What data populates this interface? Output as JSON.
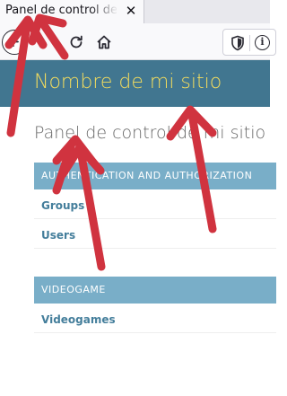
{
  "browser": {
    "tab_title": "Panel de control de",
    "tab_close": "✕",
    "info_glyph": "i",
    "icons": [
      "back-arrow-icon",
      "reload-icon",
      "home-icon",
      "shield-icon",
      "info-icon"
    ]
  },
  "site": {
    "name": "Nombre de mi sitio",
    "page_title": "Panel de control de mi sitio"
  },
  "modules": [
    {
      "caption": "Authentication and Authorization",
      "items": [
        {
          "label": "Groups"
        },
        {
          "label": "Users"
        }
      ]
    },
    {
      "caption": "Videogame",
      "items": [
        {
          "label": "Videogames"
        }
      ]
    }
  ],
  "colors": {
    "header_bg": "#417690",
    "site_name": "#f5dd5d",
    "caption_bg": "#79aec8",
    "link": "#447e9b",
    "annotation_arrow": "#d0333f"
  }
}
